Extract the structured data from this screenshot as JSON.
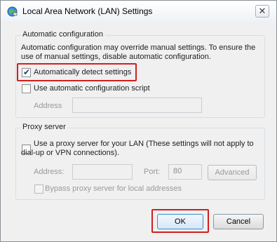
{
  "window": {
    "title": "Local Area Network (LAN) Settings",
    "close_glyph": "✕"
  },
  "automatic_configuration": {
    "legend": "Automatic configuration",
    "description_line1": "Automatic configuration may override manual settings.  To ensure the",
    "description_line2": "use of manual settings, disable automatic configuration.",
    "auto_detect_label": "Automatically detect settings",
    "auto_detect_checked": true,
    "script_label": "Use automatic configuration script",
    "script_checked": false,
    "address_label": "Address",
    "address_value": ""
  },
  "proxy_server": {
    "legend": "Proxy server",
    "use_proxy_line1": "Use a proxy server for your LAN (These settings will not apply to",
    "use_proxy_line2": "dial-up or VPN connections).",
    "use_proxy_checked": false,
    "address_label": "Address:",
    "address_value": "",
    "port_label": "Port:",
    "port_value": "80",
    "advanced_label": "Advanced",
    "bypass_label": "Bypass proxy server for local addresses",
    "bypass_checked": false
  },
  "buttons": {
    "ok_label": "OK",
    "cancel_label": "Cancel"
  },
  "colors": {
    "highlight": "#d11f1f"
  }
}
